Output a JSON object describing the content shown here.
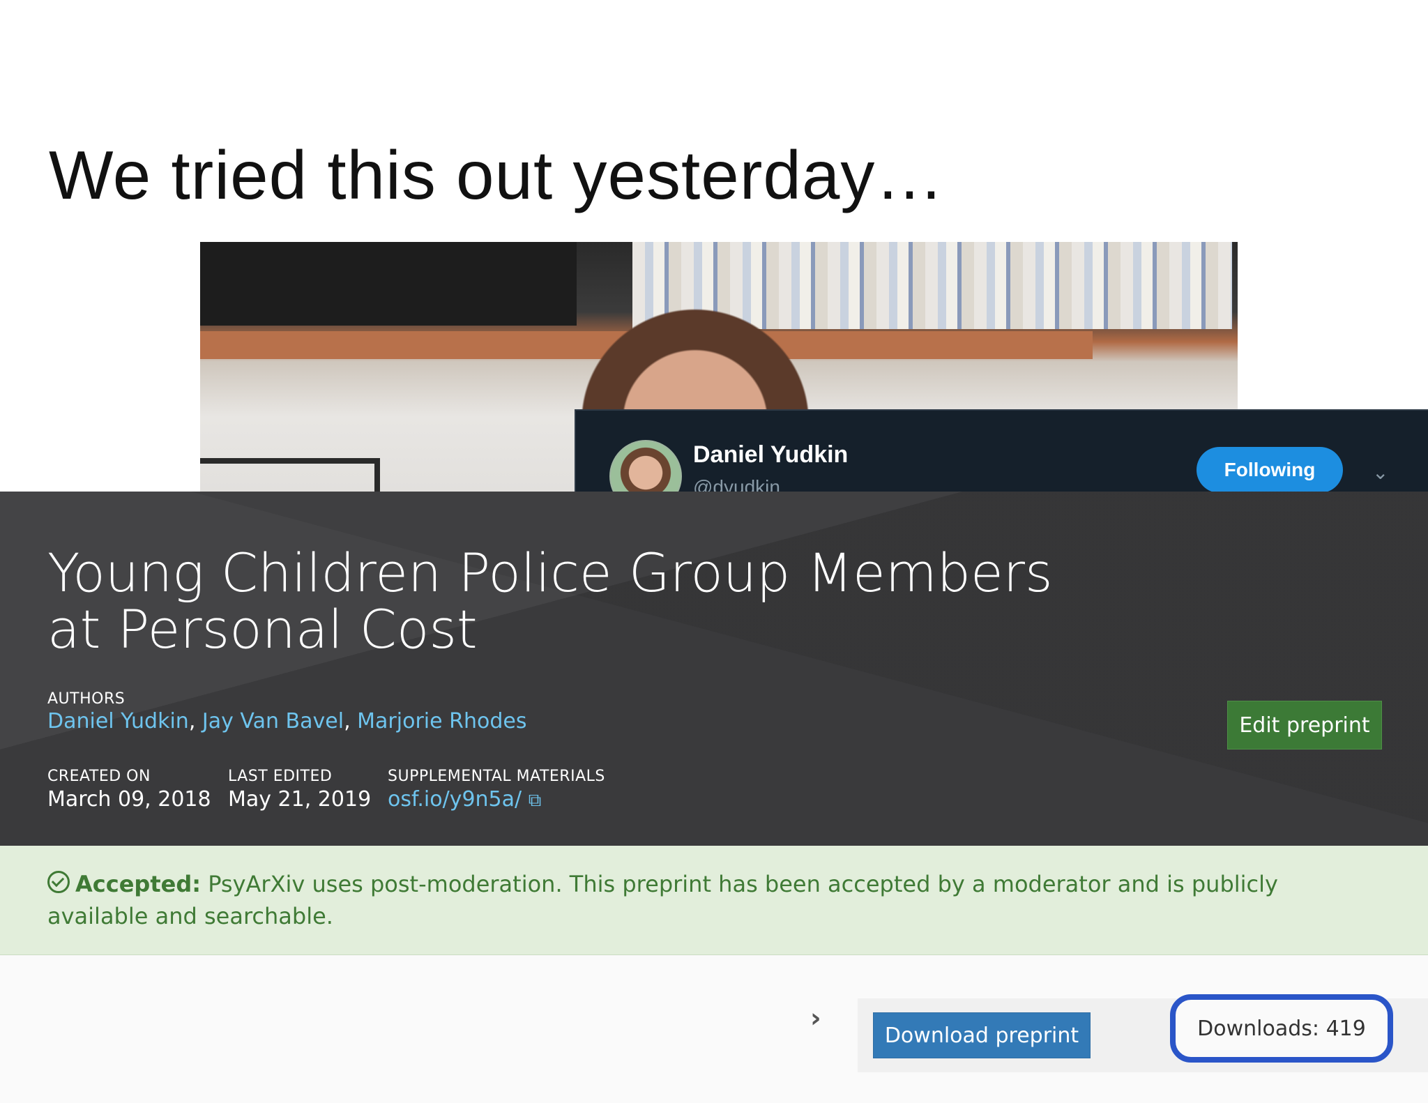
{
  "slide": {
    "title": "We tried this out yesterday…"
  },
  "twitter": {
    "name": "Daniel Yudkin",
    "handle": "@dyudkin",
    "follow_label": "Following",
    "menu_icon": "chevron-down-icon"
  },
  "preprint": {
    "title": "Young Children Police Group Members at Personal Cost",
    "authors_label": "AUTHORS",
    "authors": [
      "Daniel Yudkin",
      "Jay Van Bavel",
      "Marjorie Rhodes"
    ],
    "created_label": "CREATED ON",
    "created_value": "March 09, 2018",
    "edited_label": "LAST EDITED",
    "edited_value": "May 21, 2019",
    "supp_label": "SUPPLEMENTAL MATERIALS",
    "supp_value": "osf.io/y9n5a/",
    "edit_button": "Edit preprint"
  },
  "status": {
    "icon": "check-circle-icon",
    "label": "Accepted:",
    "message": " PsyArXiv uses post-moderation. This preprint has been accepted by a moderator and is publicly available and searchable."
  },
  "actions": {
    "download_button": "Download preprint",
    "downloads": "Downloads: 419",
    "expand_icon": "chevron-right-icon"
  },
  "colors": {
    "header_bg": "#3a3a3c",
    "link": "#6ec4ee",
    "accept_bg": "#e2eedb",
    "accept_text": "#3f7a35",
    "edit_btn": "#3c7a36",
    "download_btn": "#337ab7",
    "highlight": "#2a55c8",
    "twitter_follow": "#1d8ee0"
  }
}
